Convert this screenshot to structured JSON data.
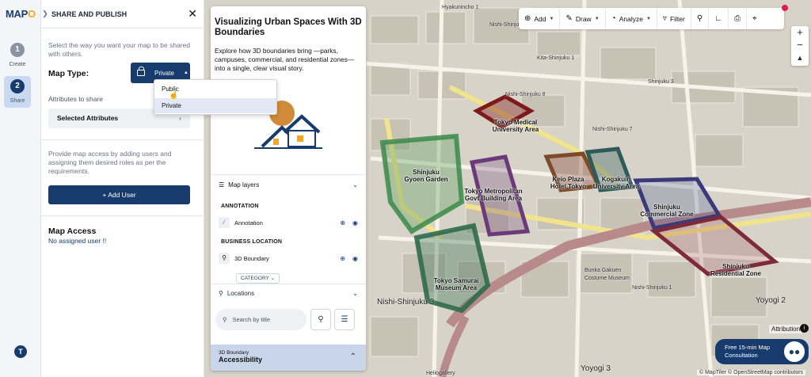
{
  "app": {
    "logo_text": "MAP",
    "logo_accent": "O",
    "brand_color": "#173b6c"
  },
  "rail": {
    "steps": [
      {
        "num": "1",
        "label": "Create"
      },
      {
        "num": "2",
        "label": "Share"
      }
    ],
    "help_label": "T"
  },
  "share": {
    "title": "SHARE AND PUBLISH",
    "intro": "Select the way you want your map to be shared with others.",
    "map_type_label": "Map Type:",
    "map_type_value": "Private",
    "options": [
      "Public",
      "Private"
    ],
    "attributes_label": "Attributes to share",
    "attributes_value": "Selected Attributes",
    "access_text": "Provide map access by adding users and assigning them desired roles as per the requirements.",
    "add_user_label": "+ Add User",
    "map_access_title": "Map Access",
    "no_user_text": "No assigned user !!"
  },
  "toolbar": {
    "add": "Add",
    "draw": "Draw",
    "analyze": "Analyze",
    "filter": "Filter"
  },
  "story": {
    "title": "Visualizing Urban Spaces With 3D Boundaries",
    "text": "Explore how 3D boundaries bring —parks, campuses, commercial, and residential zones—into a single, clear visual story.",
    "layers_title": "Map layers",
    "group_annotation": "ANNOTATION",
    "layer_annotation": "Annotation",
    "group_business": "BUSINESS LOCATION",
    "layer_boundary": "3D Boundary",
    "category_btn": "CATEGORY",
    "locations_title": "Locations",
    "search_placeholder": "Search by title",
    "access_sub": "3D Boundary",
    "access_main": "Accessibility"
  },
  "map": {
    "places": [
      "Tokyo Medical University Area",
      "Shinjuku Gyoen Garden",
      "Tokyo Metropolitan Govt Building Area",
      "Keio Plaza Hotel Tokyo",
      "Kogakuin University Area",
      "Shinjuku Commercial Zone",
      "Shinjuku Residential Zone",
      "Tokyo Samurai Museum Area"
    ],
    "streets": [
      "Nishi-Shinjuku 6",
      "Nishi-Shinjuku 8",
      "Nishi-Shinjuku 7",
      "Nishi-Shinjuku 3",
      "Yoyogi 2",
      "Yoyogi 3",
      "Hyakunincho 1",
      "Kita-Shinjuku 1",
      "Bunka Gakuen",
      "Costume Museum",
      "Heliogallery",
      "Shinjuku 3",
      "Nishi-Shinjuku 1"
    ],
    "attribution": "Attribution",
    "consult": "Free 15-min Map Consultation",
    "credits": "© MapTiler © OpenStreetMap contributors"
  }
}
